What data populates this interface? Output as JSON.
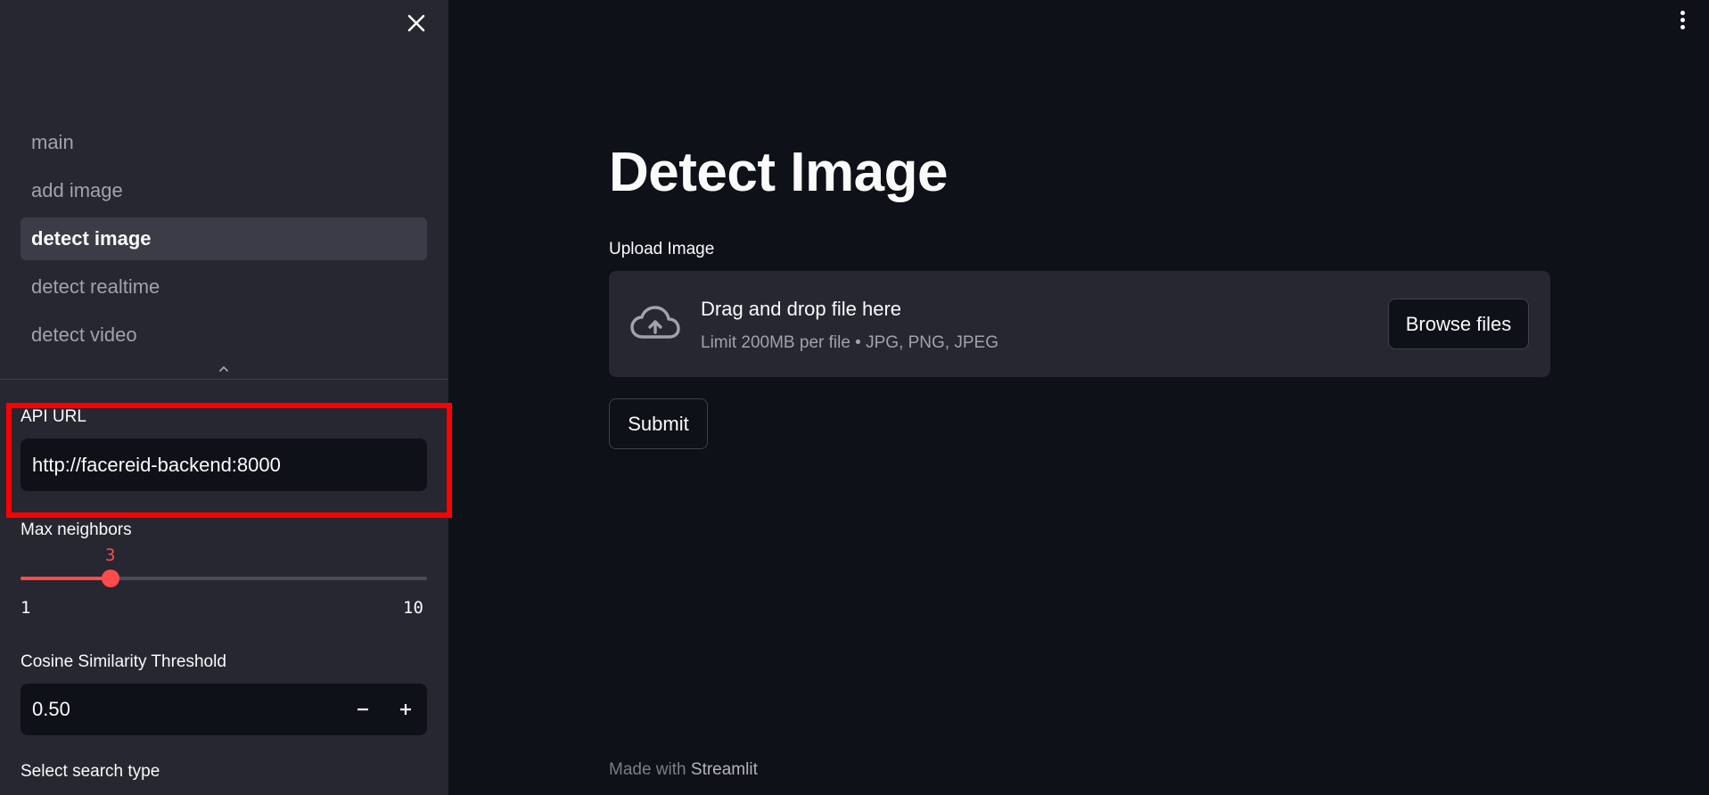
{
  "sidebar": {
    "nav_items": [
      {
        "label": "main"
      },
      {
        "label": "add image"
      },
      {
        "label": "detect image",
        "active": true
      },
      {
        "label": "detect realtime"
      },
      {
        "label": "detect video"
      }
    ],
    "api_url": {
      "label": "API URL",
      "value": "http://facereid-backend:8000"
    },
    "max_neighbors": {
      "label": "Max neighbors",
      "value": "3",
      "min": "1",
      "max": "10",
      "fill_fraction": 0.222
    },
    "cosine_threshold": {
      "label": "Cosine Similarity Threshold",
      "value": "0.50"
    },
    "search_type": {
      "label": "Select search type"
    }
  },
  "main": {
    "title": "Detect Image",
    "upload": {
      "label": "Upload Image",
      "drop_text": "Drag and drop file here",
      "limit_text": "Limit 200MB per file • JPG, PNG, JPEG",
      "browse_label": "Browse files"
    },
    "submit_label": "Submit",
    "footer": {
      "prefix": "Made with",
      "link": "Streamlit"
    }
  },
  "colors": {
    "accent": "#ff4b4b",
    "highlight": "#ff0000",
    "background": "#0e1117",
    "sidebar_bg": "#262730"
  },
  "icons": {
    "close": "close-icon",
    "collapse": "chevron-up-icon",
    "menu": "kebab-menu-icon",
    "upload": "cloud-upload-icon"
  }
}
